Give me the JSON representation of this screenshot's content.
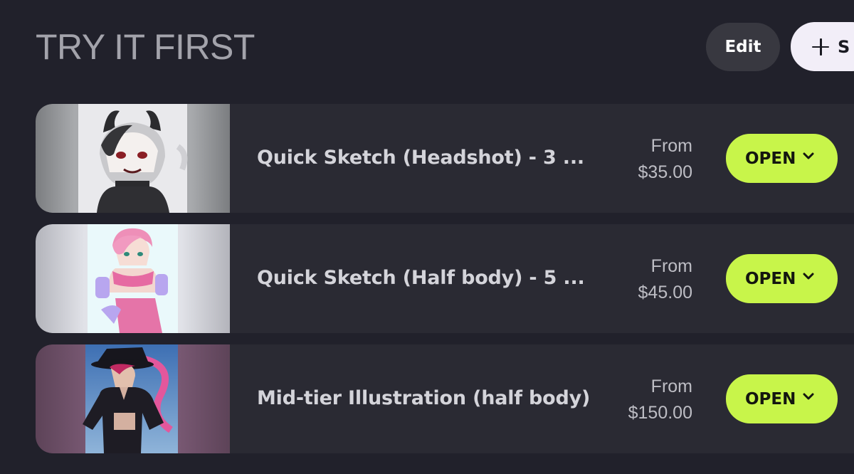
{
  "section": {
    "title": "TRY IT FIRST"
  },
  "toolbar": {
    "edit_label": "Edit",
    "add_label": "S"
  },
  "colors": {
    "background": "#21212b",
    "card": "#2a2a33",
    "accent": "#c8f54a",
    "edit_button": "#383840",
    "add_button": "#f2eef8"
  },
  "items": [
    {
      "title": "Quick Sketch (Headshot) - 3 ...",
      "price_prefix": "From",
      "price": "$35.00",
      "action_label": "OPEN",
      "action_icon": "chevron-down-icon",
      "thumbnail_icon": "character-art-image"
    },
    {
      "title": "Quick Sketch (Half body) - 5 ...",
      "price_prefix": "From",
      "price": "$45.00",
      "action_label": "OPEN",
      "action_icon": "chevron-down-icon",
      "thumbnail_icon": "character-art-image"
    },
    {
      "title": "Mid-tier Illustration (half body)",
      "price_prefix": "From",
      "price": "$150.00",
      "action_label": "OPEN",
      "action_icon": "chevron-down-icon",
      "thumbnail_icon": "character-art-image"
    }
  ]
}
